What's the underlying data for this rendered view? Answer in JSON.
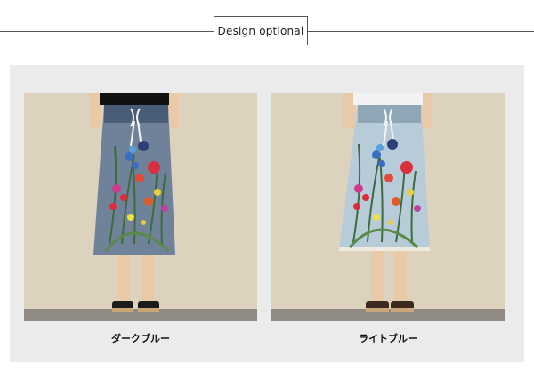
{
  "header": {
    "title": "Design optional"
  },
  "products": [
    {
      "caption": "ダークブルー",
      "denim_color": "#6f8299",
      "denim_dark": "#4a5d76",
      "top_color": "#111111"
    },
    {
      "caption": "ライトブルー",
      "denim_color": "#b7ccd8",
      "denim_dark": "#8ea6b6",
      "top_color": "#f2f2f2"
    }
  ]
}
